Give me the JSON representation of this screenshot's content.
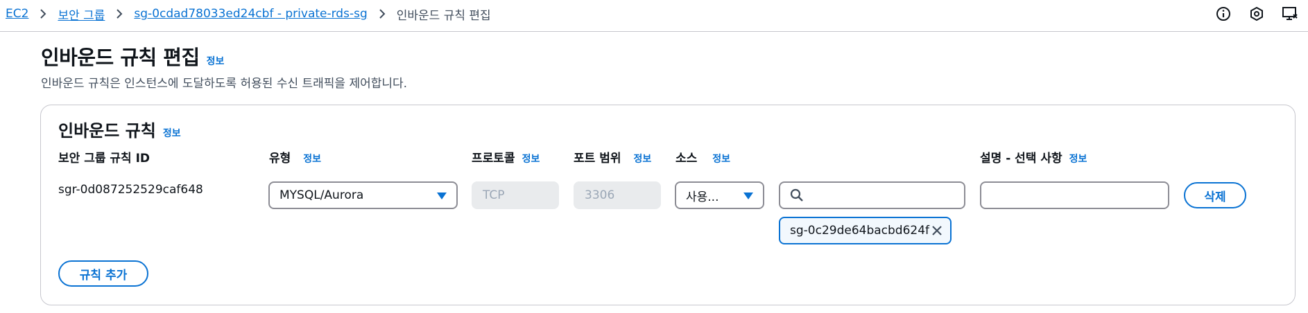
{
  "breadcrumb": {
    "items": [
      {
        "label": "EC2"
      },
      {
        "label": "보안 그룹"
      },
      {
        "label": "sg-0cdad78033ed24cbf - private-rds-sg"
      }
    ],
    "current": "인바운드 규칙 편집"
  },
  "top_icons": [
    "info-icon",
    "settings-hex-icon",
    "feedback-icon"
  ],
  "page": {
    "title": "인바운드 규칙 편집",
    "info": "정보",
    "description": "인바운드 규칙은 인스턴스에 도달하도록 허용된 수신 트래픽을 제어합니다."
  },
  "section": {
    "title": "인바운드 규칙",
    "info": "정보"
  },
  "columns": {
    "rule_id": "보안 그룹 규칙 ID",
    "type": "유형",
    "type_info": "정보",
    "protocol": "프로토콜",
    "protocol_info": "정보",
    "port_range": "포트 범위",
    "port_range_info": "정보",
    "source": "소스",
    "source_info": "정보",
    "description": "설명 - 선택 사항",
    "description_info": "정보"
  },
  "rule": {
    "id": "sgr-0d087252529caf648",
    "type": "MYSQL/Aurora",
    "protocol": "TCP",
    "port_range": "3306",
    "source_select": "사용...",
    "source_search": "",
    "source_token": "sg-0c29de64bacbd624f",
    "description": "",
    "delete_label": "삭제"
  },
  "add_rule_label": "규칙 추가",
  "colors": {
    "link": "#0972d3",
    "border": "#8c8c94",
    "disabled_bg": "#e9ebed"
  }
}
